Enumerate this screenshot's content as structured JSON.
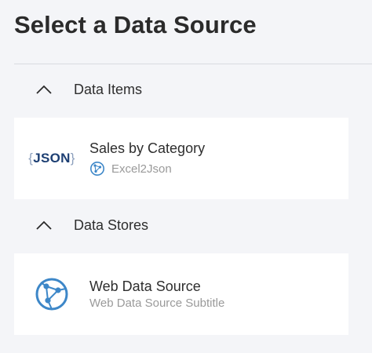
{
  "page": {
    "title": "Select a Data Source"
  },
  "sections": {
    "data_items": {
      "label": "Data Items",
      "expanded": true,
      "item": {
        "icon_open": "{",
        "icon_text": "JSON",
        "icon_close": "}",
        "title": "Sales by Category",
        "subtitle": "Excel2Json",
        "subtitle_icon": "globe-network-icon"
      }
    },
    "data_stores": {
      "label": "Data Stores",
      "expanded": true,
      "item": {
        "icon": "web-data-source-icon",
        "title": "Web Data Source",
        "subtitle": "Web Data Source Subtitle"
      }
    }
  },
  "colors": {
    "background": "#f4f5f8",
    "card": "#ffffff",
    "accent_blue": "#3d87c8",
    "json_text": "#1d3f73"
  }
}
